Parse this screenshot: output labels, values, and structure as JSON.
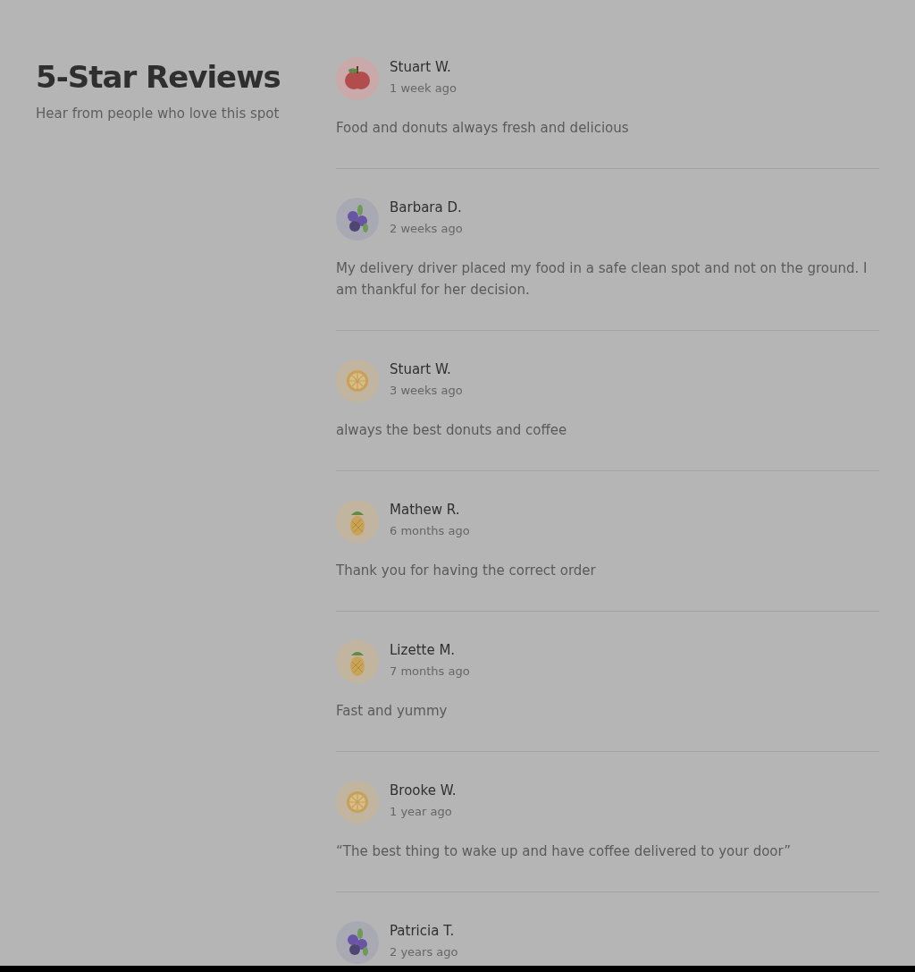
{
  "header": {
    "title": "5-Star Reviews",
    "subtitle": "Hear from people who love this spot"
  },
  "reviews": [
    {
      "kind": "apple",
      "name": "Stuart W.",
      "date": "1 week ago",
      "text": "Food and donuts always fresh and delicious"
    },
    {
      "kind": "blueberry",
      "name": "Barbara D.",
      "date": "2 weeks ago",
      "text": "My delivery driver placed my food in a safe clean spot and not on the ground. I am thankful for her decision."
    },
    {
      "kind": "orange",
      "name": "Stuart W.",
      "date": "3 weeks ago",
      "text": "always the best donuts and coffee"
    },
    {
      "kind": "pineapple",
      "name": "Mathew R.",
      "date": "6 months ago",
      "text": "Thank you for having the correct order"
    },
    {
      "kind": "pineapple",
      "name": "Lizette M.",
      "date": "7 months ago",
      "text": "Fast and yummy"
    },
    {
      "kind": "orange",
      "name": "Brooke W.",
      "date": "1 year ago",
      "text": "“The best thing to wake up and have coffee delivered to your door”"
    },
    {
      "kind": "blueberry",
      "name": "Patricia T.",
      "date": "2 years ago"
    }
  ]
}
